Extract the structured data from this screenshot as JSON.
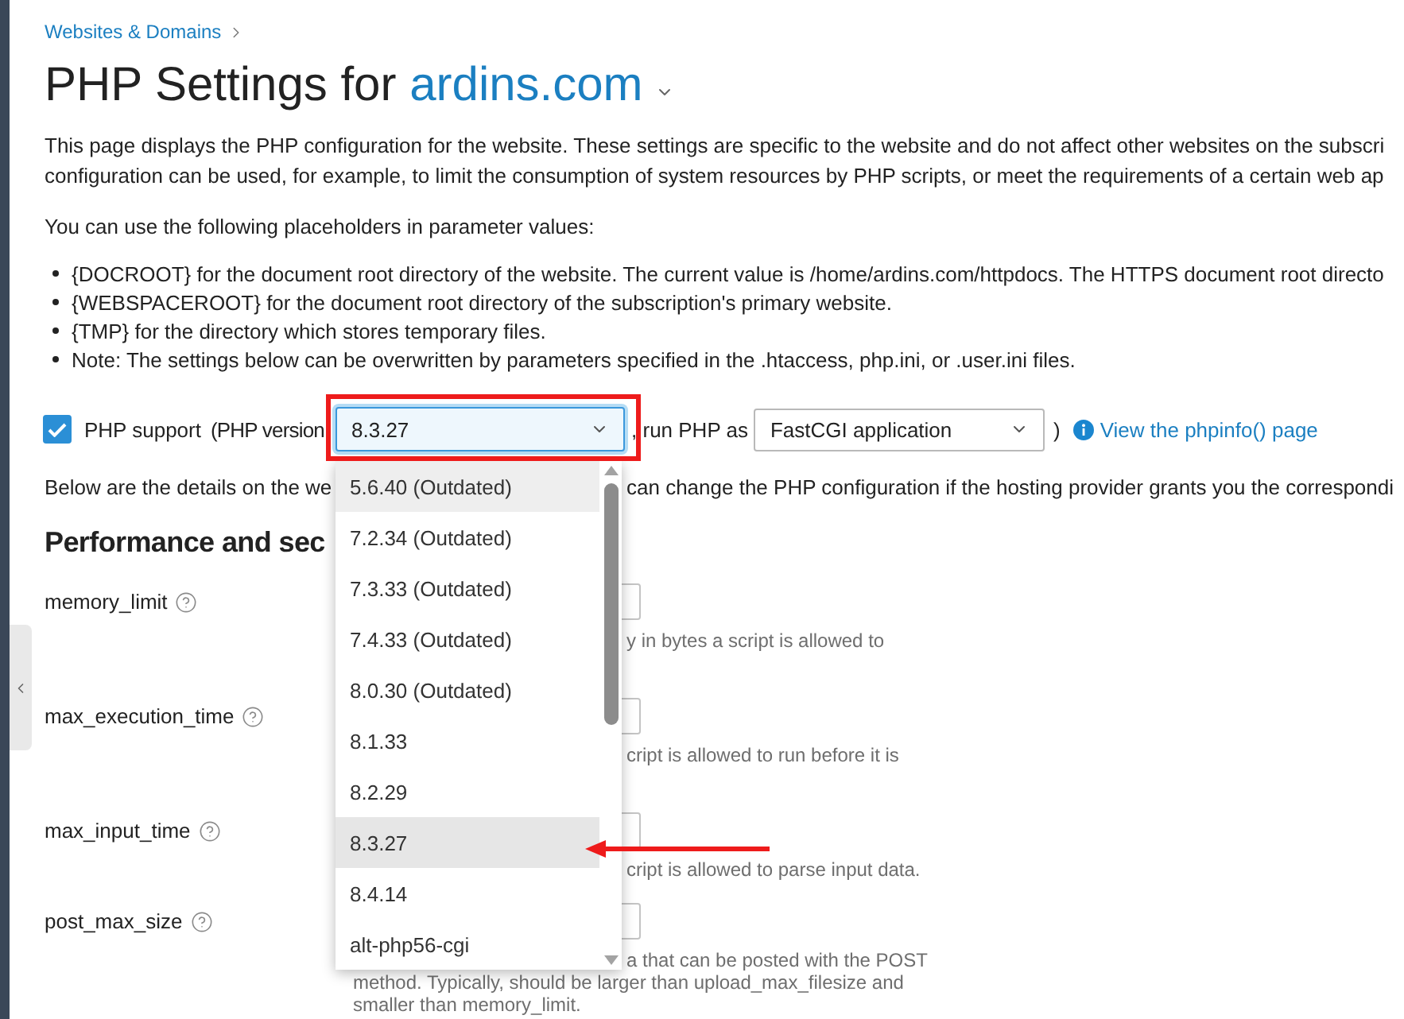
{
  "breadcrumb": {
    "label": "Websites & Domains"
  },
  "title": {
    "prefix": "PHP Settings for",
    "domain": "ardins.com"
  },
  "intro_lines": [
    "This page displays the PHP configuration for the website. These settings are specific to the website and do not affect other websites on the subscri",
    "configuration can be used, for example, to limit the consumption of system resources by PHP scripts, or meet the requirements of a certain web ap"
  ],
  "placeholders_intro": "You can use the following placeholders in parameter values:",
  "placeholders": [
    "{DOCROOT} for the document root directory of the website. The current value is /home/ardins.com/httpdocs. The HTTPS document root directo",
    "{WEBSPACEROOT} for the document root directory of the subscription's primary website.",
    "{TMP} for the directory which stores temporary files.",
    "Note: The settings below can be overwritten by parameters specified in the .htaccess, php.ini, or .user.ini files."
  ],
  "php_support": {
    "label": "PHP support",
    "checked": true,
    "version_label": "(PHP version",
    "version": "8.3.27",
    "run_label": ", run PHP as",
    "handler": "FastCGI application",
    "close_paren": ")",
    "phpinfo_link": "View the phpinfo() page"
  },
  "version_dropdown": {
    "expanded": true,
    "options": [
      {
        "label": "5.6.40 (Outdated)",
        "selected": false,
        "hovered": true
      },
      {
        "label": "7.2.34 (Outdated)",
        "selected": false,
        "hovered": false
      },
      {
        "label": "7.3.33 (Outdated)",
        "selected": false,
        "hovered": false
      },
      {
        "label": "7.4.33 (Outdated)",
        "selected": false,
        "hovered": false
      },
      {
        "label": "8.0.30 (Outdated)",
        "selected": false,
        "hovered": false
      },
      {
        "label": "8.1.33",
        "selected": false,
        "hovered": false
      },
      {
        "label": "8.2.29",
        "selected": false,
        "hovered": false
      },
      {
        "label": "8.3.27",
        "selected": true,
        "hovered": false
      },
      {
        "label": "8.4.14",
        "selected": false,
        "hovered": false
      },
      {
        "label": "alt-php56-cgi",
        "selected": false,
        "hovered": false
      }
    ]
  },
  "details_text": [
    "Below are the details on the we",
    "can change the PHP configuration if the hosting provider grants you the correspondi"
  ],
  "section_title": "Performance and sec",
  "settings": [
    {
      "name": "memory_limit",
      "description": [
        "y in bytes a script is allowed to"
      ]
    },
    {
      "name": "max_execution_time",
      "description": [
        "cript is allowed to run before it is"
      ]
    },
    {
      "name": "max_input_time",
      "description": [
        "cript is allowed to parse input data."
      ]
    },
    {
      "name": "post_max_size",
      "description": [
        "a that can be posted with the POST",
        "method. Typically, should be larger than upload_max_filesize and",
        "smaller than memory_limit."
      ]
    }
  ]
}
